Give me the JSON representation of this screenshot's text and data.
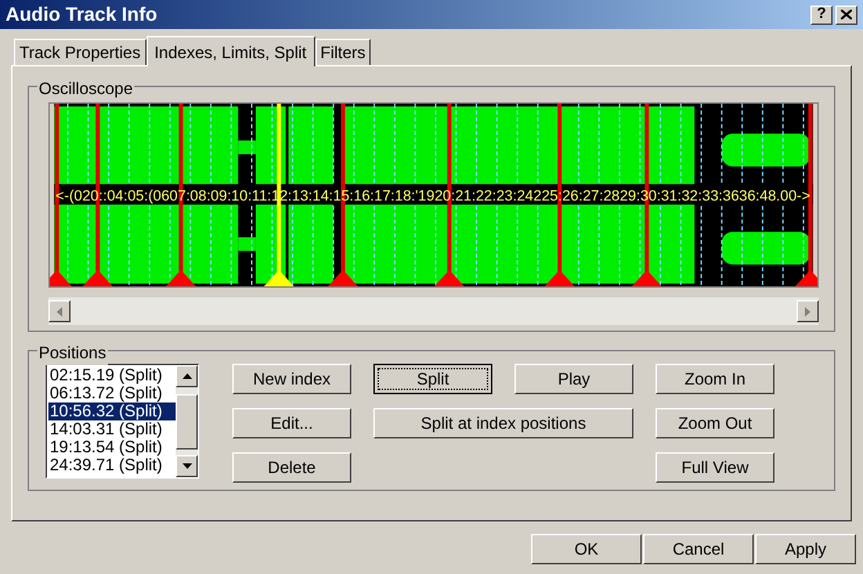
{
  "window": {
    "title": "Audio Track Info",
    "help": "?"
  },
  "tabs": [
    {
      "label": "Track Properties",
      "selected": false
    },
    {
      "label": "Indexes, Limits, Split",
      "selected": true
    },
    {
      "label": "Filters",
      "selected": false
    }
  ],
  "oscilloscope": {
    "label": "Oscilloscope",
    "time_scale": "<-(020::04:05:(0607:08:09:10:11:12:13:14:15:16:17:18:'1920:21:22:23:24225:26:27:2829:30:31:32:33:3636:48.00->"
  },
  "positions": {
    "label": "Positions",
    "items": [
      {
        "text": "02:15.19 (Split)",
        "selected": false
      },
      {
        "text": "06:13.72 (Split)",
        "selected": false
      },
      {
        "text": "10:56.32 (Split)",
        "selected": true
      },
      {
        "text": "14:03.31 (Split)",
        "selected": false
      },
      {
        "text": "19:13.54 (Split)",
        "selected": false
      },
      {
        "text": "24:39.71 (Split)",
        "selected": false
      }
    ]
  },
  "buttons": [
    {
      "label": "New index",
      "focused": false
    },
    {
      "label": "Split",
      "focused": true
    },
    {
      "label": "Play",
      "focused": false
    },
    {
      "label": "Zoom In",
      "focused": false
    },
    {
      "label": "Edit...",
      "focused": false
    },
    {
      "label": "Split at index positions",
      "focused": false
    },
    {
      "label": "Zoom Out",
      "focused": false
    },
    {
      "label": "Delete",
      "focused": false
    },
    {
      "label": "Full View",
      "focused": false
    }
  ],
  "dialog_buttons": [
    "OK",
    "Cancel",
    "Apply"
  ]
}
